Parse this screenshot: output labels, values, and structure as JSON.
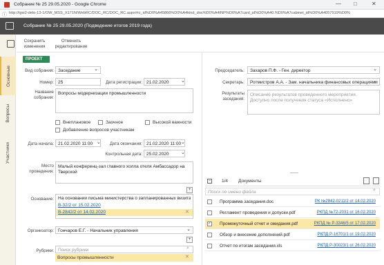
{
  "window": {
    "title": "Собрание № 25  29.05.2020 - Google Chrome",
    "minimize": "—",
    "maximize": "□",
    "close": "✕"
  },
  "url": "http://tgw2-delo-13-1/OW_MSS_X171N/WebRC/DOC_RC/DOC_RC.aspx#rc_id%D0%A45866%D0%A4kind_doc%D0%A4INP%D0%A7card_id%D0%A40.%D0%A7cabinet_id%D0%A4057919%D0%",
  "app": {
    "title": "Собрание № 25  29.05.2020 (Подведение итогов 2019 года)"
  },
  "sidebar": {
    "tabs": [
      {
        "label": "Основные"
      },
      {
        "label": "Вопросы"
      },
      {
        "label": "Участники"
      }
    ]
  },
  "toolbar": {
    "save_label": "Сохранить изменения",
    "cancel_label": "Отменить редактирование"
  },
  "status_button": "ПРОЕКТ ⌄",
  "form": {
    "type_label": "Вид собрания:",
    "type_value": "Заседание",
    "number_label": "Номер:",
    "number_value": "25",
    "regdate_label": "Дата регистрации:",
    "regdate_value": "21.02.2020",
    "name_label": "Название собрания:",
    "name_value": "Вопросы модернизации промышленности",
    "checkboxes": [
      {
        "label": "Внеплановое"
      },
      {
        "label": "Заочное"
      },
      {
        "label": "Высокой важности"
      },
      {
        "label": "Добавление вопросов участникам"
      }
    ],
    "start_label": "Дата начала:",
    "start_value": "21.02.2020 11:00",
    "end_label": "Дата окончания:",
    "end_value": "21.02.2020 11:00",
    "control_label": "Контрольная дата:",
    "control_value": "25.02.2020",
    "place_label": "Место проведения:",
    "place_value": "Малый конференц-зал главного холла отеля Амбассадор на Тверской",
    "basis_label": "Основание:",
    "basis_text": "На основании письма министерства о запланированных визитах",
    "basis_links": [
      "В-32/2 от 15.02.2020",
      "В-2842/2 от 14.02.2020"
    ],
    "organizer_label": "Организатор:",
    "organizer_value": "Гончаров Е.Г. - Начальник управления",
    "rubrics_label": "Рубрики:",
    "rubrics_placeholder": "Поиск рубрики",
    "rubric_item": "Вопросы промышленности"
  },
  "right": {
    "chair_label": "Председатель:",
    "chair_value": "Захаров П.Ф. - Ген. директор",
    "secretary_label": "Секретарь:",
    "secretary_value": "Ротмистров А.А. - Зам. начальника финансовых операциями",
    "results_label": "Результаты заседания:",
    "results_value": "Описание результатов проведенного мероприятия. Доступно после получения статуса «Исполнено»"
  },
  "documents": {
    "counter": "1/4",
    "title": "Документы",
    "search_placeholder": "Поиск по имени файла",
    "rows": [
      {
        "name": "Программа заседания.doc",
        "ref": "РК №2842-0211/2 от 14.02.2020",
        "checked": false
      },
      {
        "name": "Регламент проведения и допуски.pdf",
        "ref": "РКПД №72-2031 от 16.02.2020",
        "checked": false
      },
      {
        "name": "Промежуточный отчет и ожидания.pdf",
        "ref": "РКПД № Р-3346/5 от 17.02.2020",
        "checked": true
      },
      {
        "name": "Обзор и внесение дополнений.pdf",
        "ref": "РКПД Р-16701/1 от 19.02.2020",
        "checked": false
      },
      {
        "name": "Отчет по итогам заседания.xls",
        "ref": "РКПД Р-30023/1 от 26.02.2020",
        "checked": false
      }
    ]
  },
  "colors": {
    "accent": "#e6b83c",
    "status_green": "#2e8b57",
    "header_dark": "#4a4a4a",
    "link": "#1a5fb4",
    "highlight": "#fbe8a6"
  },
  "icons": [
    "document-icon",
    "search-icon",
    "chevron-down-icon",
    "calendar-icon",
    "add-icon",
    "close-icon",
    "menu-icon",
    "info-icon"
  ]
}
